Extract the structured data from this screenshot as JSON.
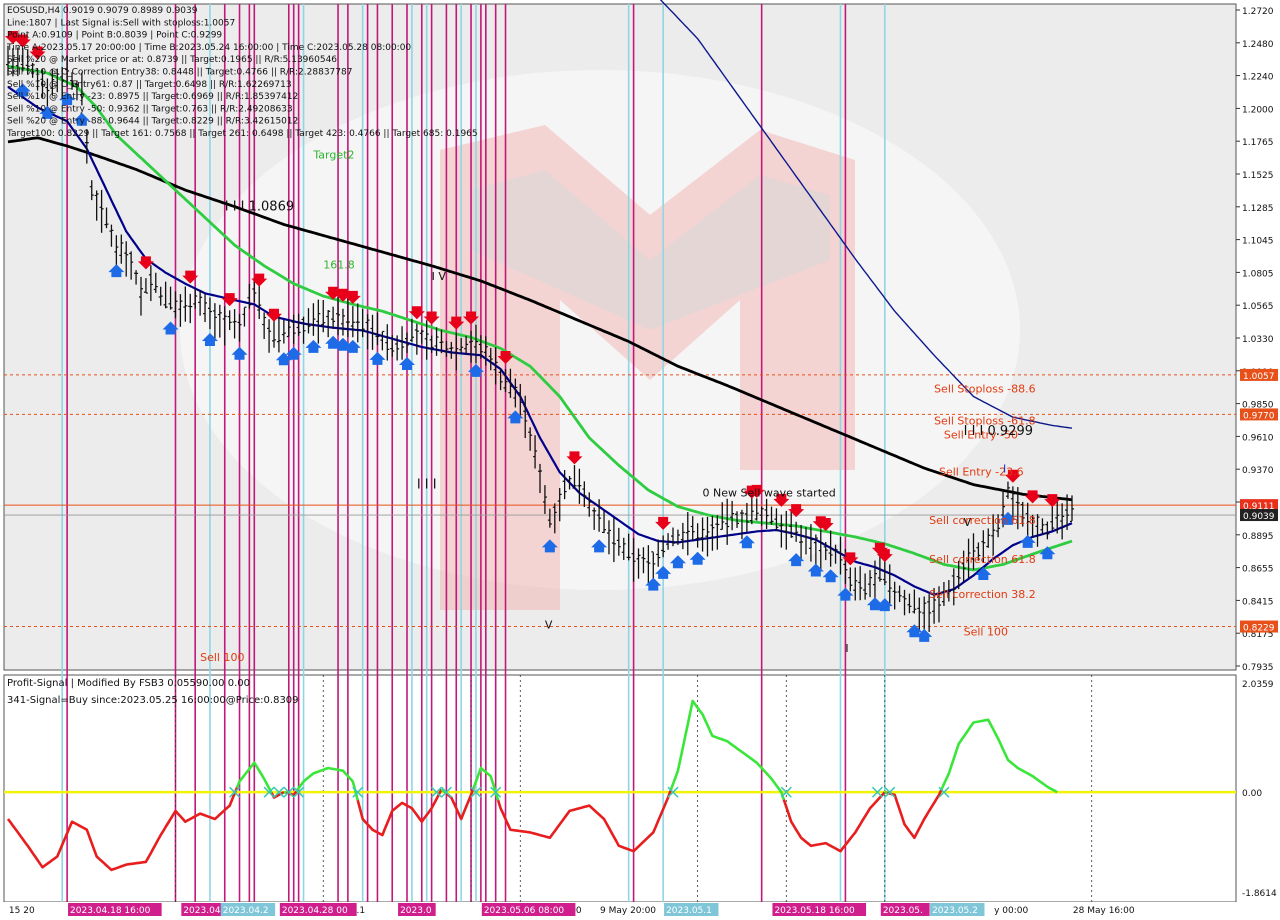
{
  "header_lines": [
    "EOSUSD,H4  0.9019 0.9079 0.8989 0.9039",
    "Line:1807 | Last Signal is:Sell with stoploss:1.0057",
    "Point A:0.9109 | Point B:0.8039 | Point C:0.9299",
    "Time A:2023.05.17 20:00:00 | Time B:2023.05.24 16:00:00 | Time C:2023.05.28 08:00:00",
    "Sell %20 @ Market price or at: 0.8739 || Target:0.1965 || R/R:5.13960546",
    "Sell %10 @ C_Correction Entry38: 0.8448 || Target:0.4766 || R/R:2.28837787",
    "Sell %10 @ C_Entry61: 0.87 || Target:0.6498 || R/R:1.62269713",
    "Sell %10 @ Entry -23: 0.8975 || Target:0.6969 || R/R:1.85397412",
    "Sell %10 @ Entry -50: 0.9362 || Target:0.763 || R/R:2.49208633",
    "Sell %20 @ Entry -88: 0.9644 || Target:0.8229 || R/R:3.42615012",
    "Target100: 0.8229 || Target 161: 0.7568 || Target 261: 0.6498 || Target 423: 0.4766 || Target 685: 0.1965"
  ],
  "sub_header_lines": [
    "Profit-Signal | Modified By FSB3 0.05590.00 0.00",
    "341-Signal=Buy since:2023.05.25 16:00:00@Price:0.8309"
  ],
  "chart_labels": [
    {
      "text": "Target2",
      "price": 1.163,
      "bar": 62,
      "color": "#2db52d"
    },
    {
      "text": "161.8",
      "price": 1.083,
      "bar": 64,
      "color": "#2db52d"
    },
    {
      "text": "I I I 1.0869",
      "price": 1.125,
      "bar": 44,
      "color": "#111111"
    },
    {
      "text": "I V",
      "price": 1.0745,
      "bar": 86,
      "color": "#111111"
    },
    {
      "text": "I I I",
      "price": 0.9232,
      "bar": 83,
      "color": "#111111"
    },
    {
      "text": "0 New Sell wave started",
      "price": 0.9173,
      "bar": 141,
      "color": "#111111"
    },
    {
      "text": "V",
      "price": 0.8213,
      "bar": 109,
      "color": "#111111"
    },
    {
      "text": "Sell Stoploss -88.6",
      "price": 0.9928,
      "bar": 188,
      "color": "#e03a10"
    },
    {
      "text": "Sell Stoploss -61.8",
      "price": 0.9695,
      "bar": 188,
      "color": "#e03a10"
    },
    {
      "text": "Sell Entry -50",
      "price": 0.9594,
      "bar": 190,
      "color": "#e03a10"
    },
    {
      "text": "I I I 0.9299",
      "price": 0.9622,
      "bar": 194,
      "color": "#111111"
    },
    {
      "text": "Sell Entry -23.6",
      "price": 0.9328,
      "bar": 189,
      "color": "#e03a10"
    },
    {
      "text": "Sell correction 61.8",
      "price": 0.8975,
      "bar": 187,
      "color": "#e03a10"
    },
    {
      "text": "Sell correction 61.8",
      "price": 0.869,
      "bar": 187,
      "color": "#e03a10"
    },
    {
      "text": "Sell correction 38.2",
      "price": 0.8435,
      "bar": 187,
      "color": "#e03a10"
    },
    {
      "text": "Sell 100",
      "price": 0.8163,
      "bar": 194,
      "color": "#e03a10"
    },
    {
      "text": "Sell 100",
      "price": 0.7978,
      "bar": 39,
      "color": "#e03a10"
    },
    {
      "text": "I",
      "price": 0.9348,
      "bar": 202,
      "color": "#1a35c8"
    },
    {
      "text": "I",
      "price": 0.8044,
      "bar": 170,
      "color": "#111111"
    },
    {
      "text": "V",
      "price": 0.8958,
      "bar": 194,
      "color": "#111111"
    }
  ],
  "price_tags": [
    {
      "label": "1.0057",
      "price": 1.0057,
      "color": "#e8501a"
    },
    {
      "label": "0.9770",
      "price": 0.977,
      "color": "#e8501a"
    },
    {
      "label": "0.9111",
      "price": 0.9111,
      "color": "#e8301a"
    },
    {
      "label": "0.9039",
      "price": 0.9039,
      "color": "#222222"
    },
    {
      "label": "0.8229",
      "price": 0.8229,
      "color": "#e8501a"
    }
  ],
  "time_tags": [
    {
      "label": "2023.04.18 16:00",
      "bar": 13,
      "color": "#d01e8c"
    },
    {
      "label": "2023.04.2",
      "bar": 36,
      "color": "#d01e8c"
    },
    {
      "label": "2023.04.28 00",
      "bar": 56,
      "color": "#d01e8c"
    },
    {
      "label": "2023.0",
      "bar": 80,
      "color": "#d01e8c"
    },
    {
      "label": "2023.05.06 08:00",
      "bar": 97,
      "color": "#d01e8c"
    },
    {
      "label": "2023.05.18 16:00",
      "bar": 156,
      "color": "#d01e8c"
    },
    {
      "label": "2023.05.",
      "bar": 178,
      "color": "#d01e8c"
    },
    {
      "label": "2023.04.2",
      "bar": 44,
      "color": "#7fc6d8"
    },
    {
      "label": "2023.05.1",
      "bar": 134,
      "color": "#7fc6d8"
    },
    {
      "label": "2023.05.2",
      "bar": 188,
      "color": "#7fc6d8"
    }
  ],
  "x_axis_labels": [
    {
      "label": "15 20",
      "bar": 1
    },
    {
      "label": "00",
      "bar": 24
    },
    {
      "label": "21",
      "bar": 27
    },
    {
      "label": "2023.04.1",
      "bar": 64
    },
    {
      "label": "04:00",
      "bar": 112
    },
    {
      "label": "9 May 20:00",
      "bar": 121
    },
    {
      "label": "20 M",
      "bar": 168
    },
    {
      "label": "y 00:00",
      "bar": 201
    },
    {
      "label": "28 May 16:00",
      "bar": 217
    }
  ],
  "colors": {
    "background": "#ffffff",
    "price_line_main": "#111111",
    "ma_fast": "#00008b",
    "ma_medium": "#2ecc40",
    "ma_slow": "#000000",
    "sell_signal": "#e8001a",
    "buy_signal": "#1e6be8",
    "vline_magenta": "#c2187a",
    "vline_cyan": "#8fd6e4",
    "osc_up": "#39e639",
    "osc_down": "#e81e1e",
    "osc_zero": "#f2f20a",
    "level_line": "#e8501a"
  },
  "chart_data": {
    "type": "line",
    "symbol": "EOSUSD",
    "timeframe": "H4",
    "ylim": [
      0.7935,
      1.273
    ],
    "y_ticks": [
      "1.2720",
      "1.2480",
      "1.2240",
      "1.2000",
      "1.1765",
      "1.1525",
      "1.1285",
      "1.1045",
      "1.0805",
      "1.0565",
      "1.0330",
      "1.0090",
      "0.9850",
      "0.9610",
      "0.9370",
      "0.9130",
      "0.8895",
      "0.8655",
      "0.8415",
      "0.8175",
      "0.7935"
    ],
    "levels": [
      {
        "name": "Sell Stoploss -88.6",
        "price": 1.0057
      },
      {
        "name": "Sell Stoploss -61.8",
        "price": 0.977
      },
      {
        "name": "Point C / entry",
        "price": 0.9111
      },
      {
        "name": "Sell 100",
        "price": 0.8229
      }
    ],
    "price_keypoints": [
      [
        0,
        1.235
      ],
      [
        4,
        1.23
      ],
      [
        8,
        1.215
      ],
      [
        12,
        1.225
      ],
      [
        15,
        1.21
      ],
      [
        17,
        1.14
      ],
      [
        19,
        1.125
      ],
      [
        22,
        1.1
      ],
      [
        25,
        1.09
      ],
      [
        27,
        1.065
      ],
      [
        29,
        1.075
      ],
      [
        32,
        1.06
      ],
      [
        35,
        1.055
      ],
      [
        38,
        1.062
      ],
      [
        41,
        1.05
      ],
      [
        44,
        1.045
      ],
      [
        47,
        1.04
      ],
      [
        50,
        1.07
      ],
      [
        52,
        1.045
      ],
      [
        54,
        1.032
      ],
      [
        58,
        1.04
      ],
      [
        62,
        1.045
      ],
      [
        66,
        1.048
      ],
      [
        70,
        1.045
      ],
      [
        74,
        1.04
      ],
      [
        78,
        1.025
      ],
      [
        82,
        1.035
      ],
      [
        86,
        1.03
      ],
      [
        90,
        1.025
      ],
      [
        94,
        1.03
      ],
      [
        98,
        1.02
      ],
      [
        100,
        1.005
      ],
      [
        104,
        0.99
      ],
      [
        106,
        0.96
      ],
      [
        108,
        0.935
      ],
      [
        110,
        0.9
      ],
      [
        113,
        0.925
      ],
      [
        116,
        0.93
      ],
      [
        119,
        0.905
      ],
      [
        122,
        0.89
      ],
      [
        126,
        0.875
      ],
      [
        130,
        0.868
      ],
      [
        134,
        0.885
      ],
      [
        138,
        0.892
      ],
      [
        142,
        0.89
      ],
      [
        146,
        0.9
      ],
      [
        150,
        0.903
      ],
      [
        154,
        0.905
      ],
      [
        158,
        0.895
      ],
      [
        162,
        0.885
      ],
      [
        166,
        0.88
      ],
      [
        169,
        0.875
      ],
      [
        171,
        0.855
      ],
      [
        174,
        0.85
      ],
      [
        177,
        0.862
      ],
      [
        180,
        0.848
      ],
      [
        183,
        0.84
      ],
      [
        186,
        0.835
      ],
      [
        189,
        0.84
      ],
      [
        192,
        0.855
      ],
      [
        195,
        0.875
      ],
      [
        198,
        0.88
      ],
      [
        201,
        0.895
      ],
      [
        203,
        0.92
      ],
      [
        205,
        0.91
      ],
      [
        208,
        0.9
      ],
      [
        211,
        0.895
      ],
      [
        214,
        0.902
      ],
      [
        216,
        0.904
      ]
    ],
    "ma_fast_keypoints": [
      [
        0,
        1.215
      ],
      [
        6,
        1.2
      ],
      [
        12,
        1.19
      ],
      [
        16,
        1.17
      ],
      [
        20,
        1.14
      ],
      [
        24,
        1.11
      ],
      [
        28,
        1.09
      ],
      [
        32,
        1.08
      ],
      [
        36,
        1.072
      ],
      [
        40,
        1.065
      ],
      [
        46,
        1.06
      ],
      [
        50,
        1.057
      ],
      [
        54,
        1.048
      ],
      [
        60,
        1.043
      ],
      [
        66,
        1.04
      ],
      [
        72,
        1.038
      ],
      [
        78,
        1.032
      ],
      [
        84,
        1.026
      ],
      [
        90,
        1.022
      ],
      [
        96,
        1.02
      ],
      [
        100,
        1.01
      ],
      [
        104,
        0.99
      ],
      [
        108,
        0.96
      ],
      [
        112,
        0.935
      ],
      [
        116,
        0.92
      ],
      [
        120,
        0.91
      ],
      [
        124,
        0.9
      ],
      [
        128,
        0.89
      ],
      [
        132,
        0.885
      ],
      [
        136,
        0.884
      ],
      [
        140,
        0.886
      ],
      [
        144,
        0.888
      ],
      [
        148,
        0.89
      ],
      [
        152,
        0.892
      ],
      [
        156,
        0.893
      ],
      [
        160,
        0.89
      ],
      [
        164,
        0.886
      ],
      [
        168,
        0.878
      ],
      [
        172,
        0.87
      ],
      [
        176,
        0.866
      ],
      [
        180,
        0.86
      ],
      [
        184,
        0.852
      ],
      [
        188,
        0.846
      ],
      [
        192,
        0.85
      ],
      [
        196,
        0.86
      ],
      [
        200,
        0.872
      ],
      [
        204,
        0.882
      ],
      [
        208,
        0.888
      ],
      [
        212,
        0.892
      ],
      [
        216,
        0.898
      ]
    ],
    "ma_medium_keypoints": [
      [
        0,
        1.23
      ],
      [
        8,
        1.225
      ],
      [
        14,
        1.215
      ],
      [
        18,
        1.2
      ],
      [
        22,
        1.18
      ],
      [
        28,
        1.16
      ],
      [
        34,
        1.14
      ],
      [
        40,
        1.12
      ],
      [
        46,
        1.1
      ],
      [
        52,
        1.085
      ],
      [
        58,
        1.072
      ],
      [
        64,
        1.063
      ],
      [
        70,
        1.057
      ],
      [
        76,
        1.052
      ],
      [
        82,
        1.045
      ],
      [
        88,
        1.038
      ],
      [
        94,
        1.033
      ],
      [
        100,
        1.025
      ],
      [
        106,
        1.012
      ],
      [
        112,
        0.99
      ],
      [
        118,
        0.96
      ],
      [
        124,
        0.94
      ],
      [
        130,
        0.922
      ],
      [
        136,
        0.91
      ],
      [
        142,
        0.904
      ],
      [
        148,
        0.9
      ],
      [
        154,
        0.898
      ],
      [
        160,
        0.896
      ],
      [
        166,
        0.892
      ],
      [
        172,
        0.888
      ],
      [
        178,
        0.883
      ],
      [
        184,
        0.876
      ],
      [
        190,
        0.868
      ],
      [
        196,
        0.864
      ],
      [
        202,
        0.868
      ],
      [
        206,
        0.873
      ],
      [
        210,
        0.878
      ],
      [
        216,
        0.885
      ]
    ],
    "ma_slow_keypoints": [
      [
        0,
        1.175
      ],
      [
        6,
        1.178
      ],
      [
        12,
        1.172
      ],
      [
        18,
        1.165
      ],
      [
        26,
        1.155
      ],
      [
        36,
        1.14
      ],
      [
        46,
        1.128
      ],
      [
        56,
        1.115
      ],
      [
        66,
        1.105
      ],
      [
        76,
        1.095
      ],
      [
        86,
        1.085
      ],
      [
        96,
        1.074
      ],
      [
        106,
        1.06
      ],
      [
        116,
        1.045
      ],
      [
        126,
        1.03
      ],
      [
        136,
        1.012
      ],
      [
        146,
        0.998
      ],
      [
        156,
        0.983
      ],
      [
        166,
        0.968
      ],
      [
        176,
        0.953
      ],
      [
        186,
        0.938
      ],
      [
        196,
        0.926
      ],
      [
        206,
        0.919
      ],
      [
        216,
        0.915
      ]
    ],
    "ma_long_blue_keypoints": [
      [
        132,
        1.28
      ],
      [
        140,
        1.25
      ],
      [
        148,
        1.21
      ],
      [
        156,
        1.17
      ],
      [
        164,
        1.13
      ],
      [
        172,
        1.09
      ],
      [
        180,
        1.052
      ],
      [
        188,
        1.02
      ],
      [
        196,
        0.99
      ],
      [
        204,
        0.975
      ],
      [
        212,
        0.969
      ],
      [
        216,
        0.967
      ]
    ],
    "oscillator": {
      "ylim": [
        -1.8614,
        2.0359
      ],
      "y_ticks": [
        "2.0359",
        "0.00",
        "-1.8614"
      ],
      "keypoints": [
        [
          0,
          -0.5
        ],
        [
          4,
          -1.0
        ],
        [
          7,
          -1.4
        ],
        [
          10,
          -1.2
        ],
        [
          13,
          -0.55
        ],
        [
          16,
          -0.7
        ],
        [
          18,
          -1.2
        ],
        [
          21,
          -1.45
        ],
        [
          24,
          -1.35
        ],
        [
          28,
          -1.3
        ],
        [
          31,
          -0.8
        ],
        [
          34,
          -0.35
        ],
        [
          36,
          -0.55
        ],
        [
          39,
          -0.4
        ],
        [
          42,
          -0.5
        ],
        [
          45,
          -0.25
        ],
        [
          47,
          0.2
        ],
        [
          50,
          0.55
        ],
        [
          52,
          0.25
        ],
        [
          54,
          -0.1
        ],
        [
          56,
          0.0
        ],
        [
          58,
          -0.05
        ],
        [
          60,
          0.2
        ],
        [
          62,
          0.35
        ],
        [
          65,
          0.45
        ],
        [
          68,
          0.4
        ],
        [
          70,
          0.2
        ],
        [
          72,
          -0.5
        ],
        [
          74,
          -0.7
        ],
        [
          76,
          -0.8
        ],
        [
          78,
          -0.35
        ],
        [
          80,
          -0.2
        ],
        [
          82,
          -0.3
        ],
        [
          84,
          -0.55
        ],
        [
          86,
          -0.3
        ],
        [
          88,
          0.05
        ],
        [
          90,
          -0.1
        ],
        [
          92,
          -0.5
        ],
        [
          94,
          -0.05
        ],
        [
          96,
          0.45
        ],
        [
          98,
          0.3
        ],
        [
          100,
          -0.3
        ],
        [
          102,
          -0.7
        ],
        [
          106,
          -0.75
        ],
        [
          110,
          -0.85
        ],
        [
          114,
          -0.35
        ],
        [
          118,
          -0.25
        ],
        [
          121,
          -0.5
        ],
        [
          124,
          -1.0
        ],
        [
          127,
          -1.1
        ],
        [
          131,
          -0.75
        ],
        [
          134,
          -0.1
        ],
        [
          136,
          0.4
        ],
        [
          139,
          1.7
        ],
        [
          141,
          1.45
        ],
        [
          143,
          1.05
        ],
        [
          146,
          0.95
        ],
        [
          149,
          0.75
        ],
        [
          152,
          0.55
        ],
        [
          155,
          0.25
        ],
        [
          157,
          0.0
        ],
        [
          159,
          -0.55
        ],
        [
          161,
          -0.85
        ],
        [
          163,
          -1.0
        ],
        [
          166,
          -0.95
        ],
        [
          169,
          -1.1
        ],
        [
          172,
          -0.75
        ],
        [
          175,
          -0.3
        ],
        [
          178,
          0.0
        ],
        [
          180,
          -0.05
        ],
        [
          182,
          -0.6
        ],
        [
          184,
          -0.85
        ],
        [
          186,
          -0.5
        ],
        [
          189,
          -0.05
        ],
        [
          191,
          0.35
        ],
        [
          193,
          0.9
        ],
        [
          196,
          1.3
        ],
        [
          199,
          1.35
        ],
        [
          201,
          1.0
        ],
        [
          203,
          0.6
        ],
        [
          205,
          0.45
        ],
        [
          208,
          0.3
        ],
        [
          211,
          0.1
        ],
        [
          213,
          0.0
        ]
      ]
    },
    "sell_arrow_bars": [
      1,
      3,
      6,
      28,
      37,
      45,
      51,
      54,
      66,
      68,
      70,
      83,
      86,
      91,
      94,
      101,
      115,
      133,
      151,
      152,
      157,
      160,
      165,
      166,
      171,
      177,
      178,
      204,
      208,
      212
    ],
    "buy_arrow_bars": [
      3,
      8,
      12,
      15,
      22,
      33,
      41,
      47,
      56,
      58,
      62,
      66,
      68,
      70,
      75,
      81,
      95,
      103,
      110,
      120,
      131,
      133,
      136,
      140,
      150,
      160,
      164,
      167,
      170,
      176,
      178,
      184,
      186,
      198,
      203,
      207,
      211
    ]
  }
}
